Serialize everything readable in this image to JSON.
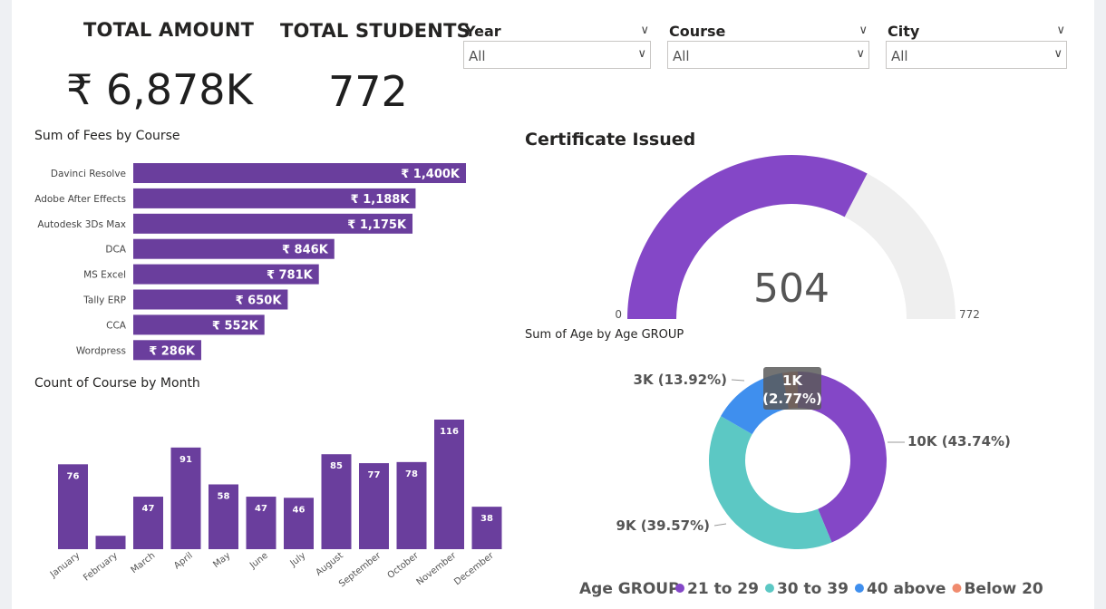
{
  "cards": {
    "total_amount": {
      "title": "TOTAL AMOUNT",
      "value": "₹ 6,878K"
    },
    "total_students": {
      "title": "TOTAL STUDENTS",
      "value": "772"
    }
  },
  "slicers": [
    {
      "label": "Year",
      "value": "All"
    },
    {
      "label": "Course",
      "value": "All"
    },
    {
      "label": "City",
      "value": "All"
    }
  ],
  "colors": {
    "bar": "#6a3e9d",
    "purple": "#8447c7",
    "teal": "#5cc8c4",
    "blue": "#3f8fee",
    "salmon": "#f08b6e",
    "gauge_track": "#efefef"
  },
  "chart_data": [
    {
      "type": "bar",
      "orientation": "horizontal",
      "title": "Sum of Fees by Course",
      "categories": [
        "Davinci Resolve",
        "Adobe After Effects",
        "Autodesk 3Ds Max",
        "DCA",
        "MS Excel",
        "Tally ERP",
        "CCA",
        "Wordpress"
      ],
      "values": [
        1400,
        1188,
        1175,
        846,
        781,
        650,
        552,
        286
      ],
      "labels": [
        "₹ 1,400K",
        "₹ 1,188K",
        "₹ 1,175K",
        "₹ 846K",
        "₹ 781K",
        "₹ 650K",
        "₹ 552K",
        "₹ 286K"
      ]
    },
    {
      "type": "bar",
      "title": "Count of Course by Month",
      "categories": [
        "January",
        "February",
        "March",
        "April",
        "May",
        "June",
        "July",
        "August",
        "September",
        "October",
        "November",
        "December"
      ],
      "values": [
        76,
        12,
        47,
        91,
        58,
        47,
        46,
        85,
        77,
        78,
        116,
        38
      ],
      "labels": [
        "76",
        "",
        "47",
        "91",
        "58",
        "47",
        "46",
        "85",
        "77",
        "78",
        "116",
        "38"
      ]
    },
    {
      "type": "gauge",
      "title": "Certificate Issued",
      "value": 504,
      "min": 0,
      "max": 772,
      "value_label": "504",
      "min_label": "0",
      "max_label": "772"
    },
    {
      "type": "pie",
      "title": "Sum of Age by Age GROUP",
      "legend_title": "Age GROUP",
      "series": [
        {
          "name": "21 to 29",
          "value": 43.74,
          "label": "10K (43.74%)",
          "color": "#8447c7"
        },
        {
          "name": "30 to 39",
          "value": 39.57,
          "label": "9K (39.57%)",
          "color": "#5cc8c4"
        },
        {
          "name": "40 above",
          "value": 13.92,
          "label": "3K (13.92%)",
          "color": "#3f8fee"
        },
        {
          "name": "Below 20",
          "value": 2.77,
          "label": "1K (2.77%)",
          "color": "#f08b6e"
        }
      ]
    }
  ]
}
